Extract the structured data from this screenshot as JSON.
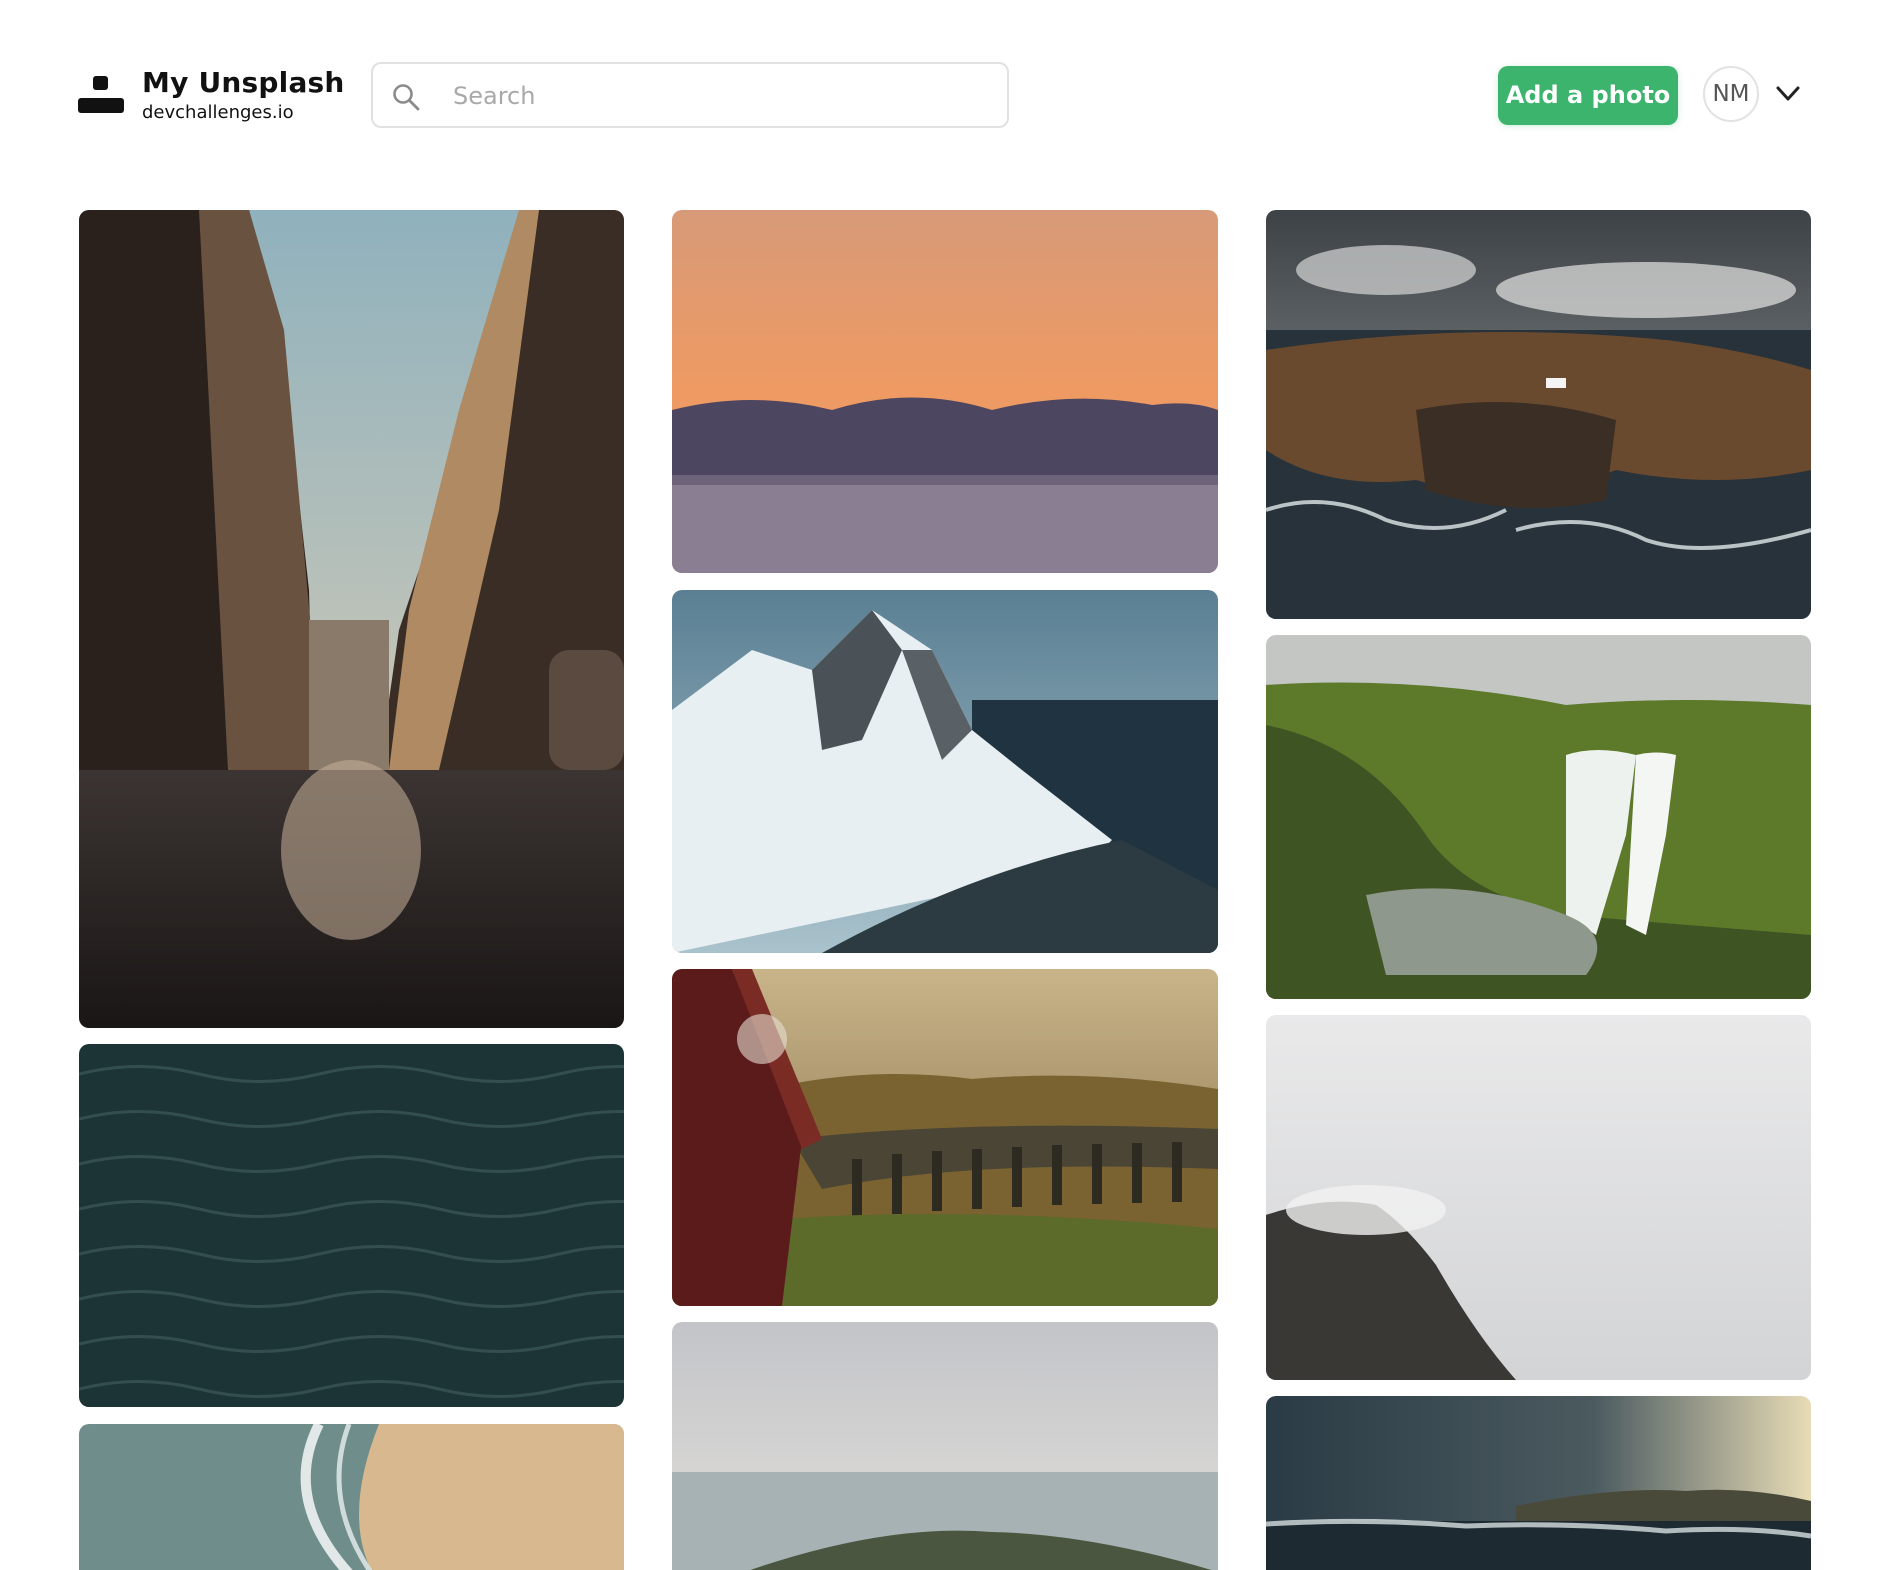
{
  "header": {
    "logo_title": "My Unsplash",
    "logo_subtitle": "devchallenges.io",
    "search_placeholder": "Search",
    "add_photo_label": "Add a photo",
    "avatar_initials": "NM"
  },
  "colors": {
    "accent": "#3db46d",
    "border": "#e1e1e1",
    "text": "#111111"
  },
  "icons": {
    "search": "search-icon",
    "menu": "chevron-down-icon",
    "logo": "logo-icon"
  },
  "gallery": {
    "columns": [
      [
        "city-street",
        "dark-ocean-water",
        "sandy-beach"
      ],
      [
        "ocean-sunset",
        "snowy-mountain",
        "steam-train-viaduct",
        "coastal-island"
      ],
      [
        "rocky-coastline-cliff",
        "green-waterfall",
        "foggy-cliff",
        "stormy-sea"
      ]
    ]
  }
}
